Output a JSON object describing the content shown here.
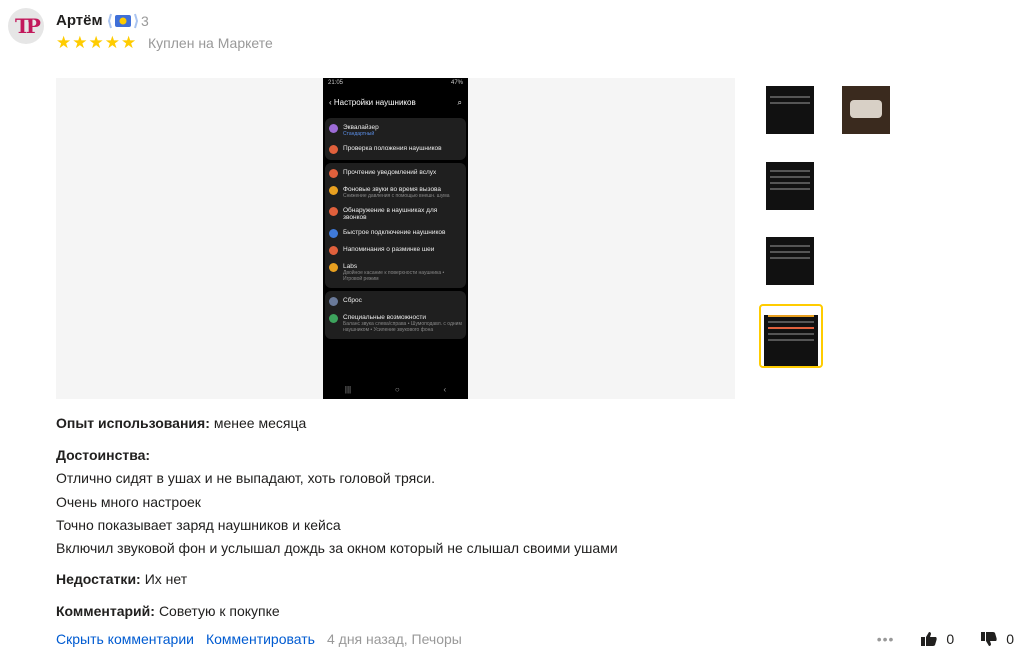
{
  "author": {
    "name": "Артём",
    "level": "3",
    "avatar_letters": "ТР"
  },
  "review": {
    "rating": 5,
    "purchase_note": "Куплен на Маркете",
    "experience_label": "Опыт использования:",
    "experience_value": "менее месяца",
    "pros_label": "Достоинства:",
    "pros": [
      "Отлично сидят в ушах и не выпадают, хоть головой тряси.",
      "Очень много настроек",
      "Точно показывает заряд наушников и кейса",
      "Включил звуковой фон и услышал дождь за окном который не слышал своими ушами"
    ],
    "cons_label": "Недостатки:",
    "cons_value": "Их нет",
    "comment_label": "Комментарий:",
    "comment_value": "Советую к покупке"
  },
  "screenshot": {
    "status_time": "21:05",
    "status_battery": "47%",
    "title": "Настройки наушников",
    "items": [
      {
        "label": "Эквалайзер",
        "sub": "Стандартный",
        "color": "#9c6bd6"
      },
      {
        "label": "Проверка положения наушников",
        "sub": "",
        "color": "#e0603c"
      },
      {
        "label": "Прочтение уведомлений вслух",
        "sub": "",
        "color": "#e0603c"
      },
      {
        "label": "Фоновые звуки во время вызова",
        "sub": "Снижение давления с помощью внешн. шума",
        "color": "#e8a020"
      },
      {
        "label": "Обнаружение в наушниках для звонков",
        "sub": "",
        "color": "#e0603c"
      },
      {
        "label": "Быстрое подключение наушников",
        "sub": "",
        "color": "#3f7ad9"
      },
      {
        "label": "Напоминания о разминке шеи",
        "sub": "",
        "color": "#e0603c"
      },
      {
        "label": "Labs",
        "sub": "Двойное касание к поверхности наушника • Игровой режим",
        "color": "#e8a020"
      },
      {
        "label": "Сброс",
        "sub": "",
        "color": "#6a7a9a"
      },
      {
        "label": "Специальные возможности",
        "sub": "Баланс звука слева/справа • Шумоподавл. с одним наушником • Усиление звукового фона",
        "color": "#3da35d"
      }
    ]
  },
  "footer": {
    "hide_comments": "Скрыть комментарии",
    "comment_action": "Комментировать",
    "date_location": "4 дня назад, Печоры",
    "likes": "0",
    "dislikes": "0"
  },
  "colors": {
    "star": "#ffcc00",
    "link": "#005bd1",
    "selected_thumb": "#ffcc00"
  }
}
